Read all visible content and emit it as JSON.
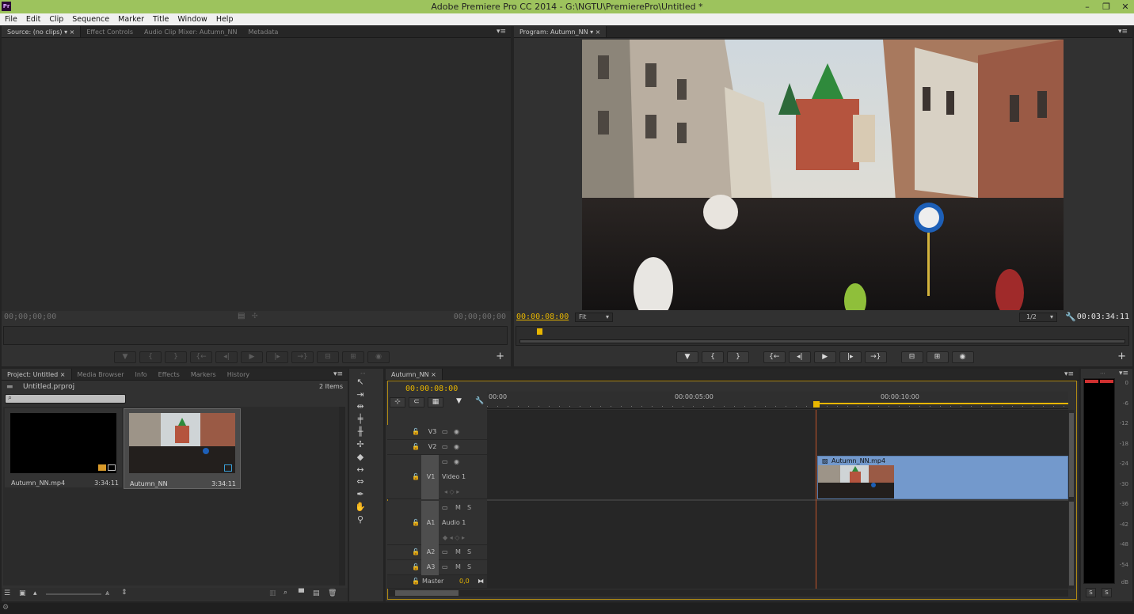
{
  "window": {
    "title": "Adobe Premiere Pro CC 2014 - G:\\NGTU\\PremierePro\\Untitled *",
    "logo": "Pr",
    "controls": [
      "–",
      "❐",
      "✕"
    ]
  },
  "menu": [
    "File",
    "Edit",
    "Clip",
    "Sequence",
    "Marker",
    "Title",
    "Window",
    "Help"
  ],
  "source_panel": {
    "tabs": [
      "Source: (no clips)",
      "Effect Controls",
      "Audio Clip Mixer: Autumn_NN",
      "Metadata"
    ],
    "timecode_in": "00;00;00;00",
    "timecode_out": "00;00;00;00"
  },
  "program_panel": {
    "tab": "Program: Autumn_NN",
    "timecode": "00:00:08:00",
    "fit": "Fit",
    "resolution": "1/2",
    "duration": "00:03:34:11"
  },
  "transport_icons": [
    "marker",
    "mark-in",
    "mark-out",
    "go-to-in",
    "step-back",
    "play",
    "step-forward",
    "go-to-out",
    "lift",
    "extract",
    "export-frame"
  ],
  "transport_glyphs": [
    "▼",
    "{",
    "}",
    "{←",
    "◂|",
    "▶",
    "|▸",
    "→}",
    "⊟",
    "⊞",
    "◉"
  ],
  "project_panel": {
    "tabs": [
      "Project: Untitled",
      "Media Browser",
      "Info",
      "Effects",
      "Markers",
      "History"
    ],
    "project_file": "Untitled.prproj",
    "item_count": "2 Items",
    "items": [
      {
        "name": "Autumn_NN.mp4",
        "duration": "3:34:11"
      },
      {
        "name": "Autumn_NN",
        "duration": "3:34:11"
      }
    ]
  },
  "timeline": {
    "tab": "Autumn_NN",
    "timecode": "00:00:08:00",
    "ruler_labels": [
      "00:00",
      "00:00:05:00",
      "00:00:10:00"
    ],
    "tracks": {
      "v3": "V3",
      "v2": "V2",
      "v1": "V1",
      "v1_name": "Video 1",
      "a1": "A1",
      "a1_name": "Audio 1",
      "a2": "A2",
      "a3": "A3",
      "master": "Master",
      "master_value": "0,0"
    },
    "clip_name": "Autumn_NN.mp4",
    "toggle_m": "M",
    "toggle_s": "S"
  },
  "audio_meter": {
    "scale": [
      "0",
      "-6",
      "-12",
      "-18",
      "-24",
      "-30",
      "-36",
      "-42",
      "-48",
      "-54",
      "dB"
    ],
    "solo_buttons": [
      "S",
      "S"
    ]
  },
  "colors": {
    "titlebar": "#9dc35d",
    "playhead": "#e8b600",
    "clip_blue": "#7399cc",
    "panel_bg": "#313131"
  }
}
